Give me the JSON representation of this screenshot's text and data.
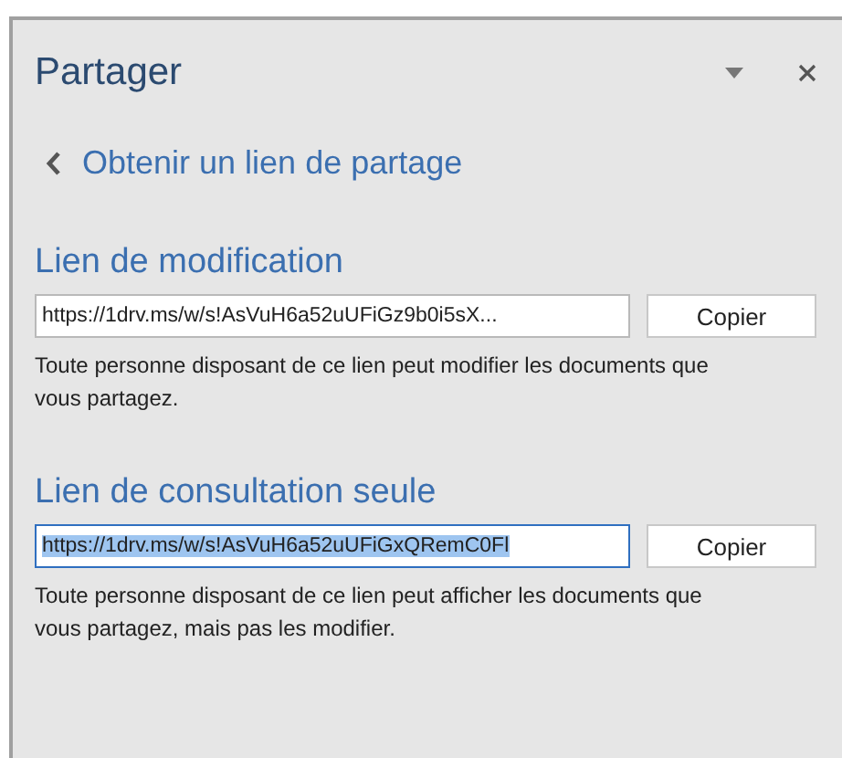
{
  "pane": {
    "title": "Partager",
    "back_link": "Obtenir un lien de partage"
  },
  "sections": [
    {
      "heading": "Lien de modification",
      "link": "https://1drv.ms/w/s!AsVuH6a52uUFiGz9b0i5sX...",
      "selected": false,
      "button": "Copier",
      "description": "Toute personne disposant de ce lien peut modifier les documents que vous partagez."
    },
    {
      "heading": "Lien de consultation seule",
      "link": "https://1drv.ms/w/s!AsVuH6a52uUFiGxQRemC0Fl",
      "selected": true,
      "button": "Copier",
      "description": "Toute personne disposant de ce lien peut afficher les documents que vous partagez, mais pas les modifier."
    }
  ]
}
